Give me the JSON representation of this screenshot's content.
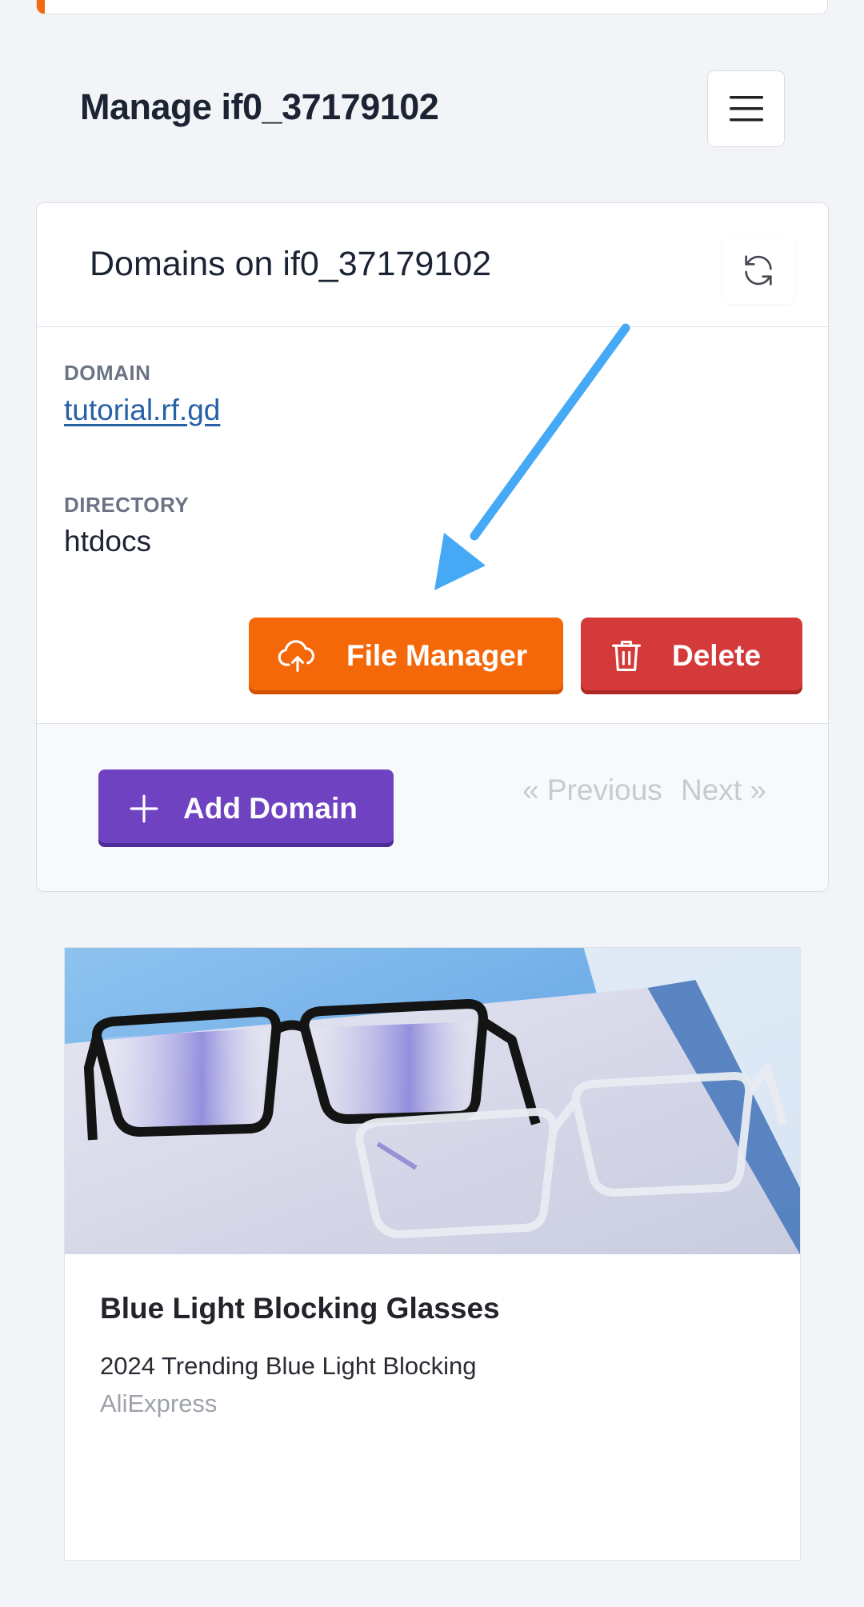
{
  "header": {
    "title": "Manage if0_37179102",
    "menu_icon": "hamburger-menu-icon"
  },
  "domains_card": {
    "title": "Domains on if0_37179102",
    "refresh_icon": "refresh-icon",
    "domain_label": "DOMAIN",
    "domain_value": "tutorial.rf.gd",
    "directory_label": "DIRECTORY",
    "directory_value": "htdocs",
    "file_manager_label": "File Manager",
    "delete_label": "Delete",
    "add_domain_label": "Add Domain",
    "previous_label": "« Previous",
    "next_label": "Next »"
  },
  "ad": {
    "title": "Blue Light Blocking Glasses",
    "description": "2024 Trending Blue Light Blocking",
    "source": "AliExpress"
  },
  "colors": {
    "file_manager": "#f5680a",
    "delete": "#d53a3a",
    "add_domain": "#6f42c1",
    "annotation_arrow": "#46a9f5",
    "link": "#2860a6"
  }
}
